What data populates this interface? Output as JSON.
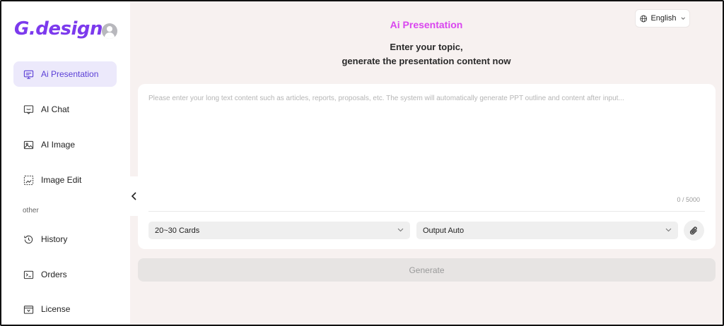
{
  "brand": {
    "logo_text": "G.design"
  },
  "sidebar": {
    "items": [
      {
        "label": "Ai Presentation",
        "icon": "presentation-icon",
        "active": true
      },
      {
        "label": "AI Chat",
        "icon": "chat-icon",
        "active": false
      },
      {
        "label": "AI Image",
        "icon": "image-icon",
        "active": false
      },
      {
        "label": "Image Edit",
        "icon": "image-edit-icon",
        "active": false
      }
    ],
    "section_label": "other",
    "other_items": [
      {
        "label": "History",
        "icon": "history-icon"
      },
      {
        "label": "Orders",
        "icon": "terminal-icon"
      },
      {
        "label": "License",
        "icon": "license-icon"
      }
    ]
  },
  "header": {
    "language": "English",
    "title": "Ai Presentation",
    "subtitle_line1": "Enter your topic,",
    "subtitle_line2": "generate the presentation content now"
  },
  "editor": {
    "placeholder": "Please enter your long text content such as articles, reports, proposals, etc. The system will automatically generate PPT outline and content after input...",
    "value": "",
    "counter": "0 / 5000",
    "cards_select": "20~30 Cards",
    "output_select": "Output Auto"
  },
  "actions": {
    "generate_label": "Generate"
  },
  "colors": {
    "accent": "#7c3aed",
    "title_pink": "#d946ef",
    "main_bg": "#f7f1f0",
    "active_bg": "#ece9fb"
  }
}
